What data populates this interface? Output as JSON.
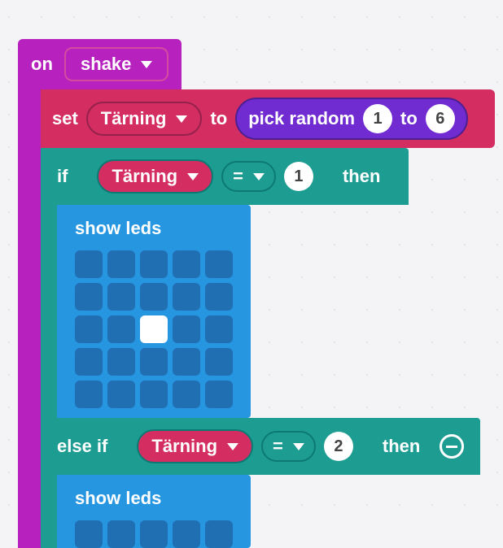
{
  "event": {
    "on_label": "on",
    "gesture": "shake"
  },
  "set": {
    "set_label": "set",
    "variable": "Tärning",
    "to_label": "to",
    "random": {
      "pick_label": "pick random",
      "low": "1",
      "to_label": "to",
      "high": "6"
    }
  },
  "if": {
    "if_label": "if",
    "then_label": "then",
    "variable": "Tärning",
    "operator": "=",
    "value": "1",
    "show_leds_label": "show leds",
    "led_on_index": 12
  },
  "elseif": {
    "elseif_label": "else if",
    "then_label": "then",
    "variable": "Tärning",
    "operator": "=",
    "value": "2",
    "show_leds_label": "show leds"
  },
  "colors": {
    "event": "#b722bf",
    "variable": "#d32d62",
    "math": "#702bd1",
    "logic": "#1d9c91",
    "basic": "#2796e1"
  }
}
